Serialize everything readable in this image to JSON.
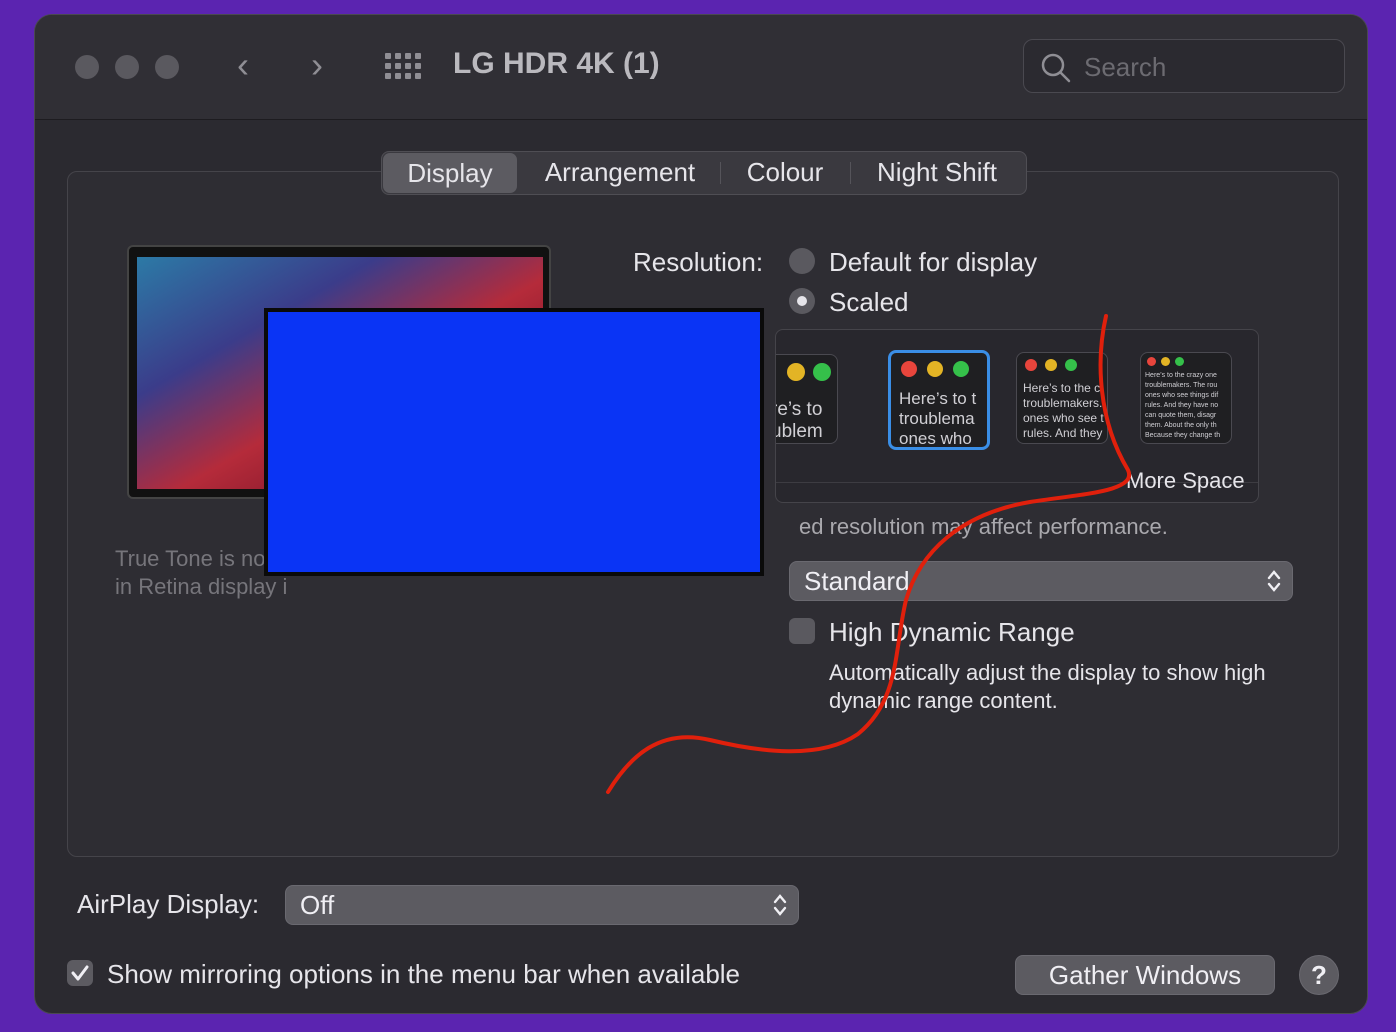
{
  "window": {
    "title": "LG HDR 4K (1)",
    "search_placeholder": "Search"
  },
  "tabs": [
    {
      "label": "Display",
      "active": true
    },
    {
      "label": "Arrangement",
      "active": false
    },
    {
      "label": "Colour",
      "active": false
    },
    {
      "label": "Night Shift",
      "active": false
    }
  ],
  "display": {
    "true_tone_line1": "True Tone is not a",
    "true_tone_line2": "in Retina display i",
    "resolution_label": "Resolution:",
    "option_default": "Default for display",
    "option_scaled": "Scaled",
    "selected_option": "Scaled",
    "scale_end_label": "More Space",
    "thumb_text_1": "re’s to\nublem",
    "thumb_text_2": "Here’s to t\ntroublema\nones who",
    "thumb_text_3": "Here’s to the c\ntroublemakers.\nones who see t\nrules. And they",
    "thumb_text_4": "Here’s to the crazy one\ntroublemakers. The rou\nones who see things dif\nrules. And they have no\ncan quote them, disagr\nthem. About the only th\nBecause they change th",
    "performance_note": "ed resolution may affect performance.",
    "preset_value": "Standard",
    "hdr_label": "High Dynamic Range",
    "hdr_checked": false,
    "hdr_desc_line1": "Automatically adjust the display to show high",
    "hdr_desc_line2": "dynamic range content."
  },
  "footer": {
    "airplay_label": "AirPlay Display:",
    "airplay_value": "Off",
    "mirroring_label": "Show mirroring options in the menu bar when available",
    "mirroring_checked": true,
    "gather_button": "Gather Windows",
    "help_button": "?"
  },
  "colors": {
    "window_bg": "#2b2a30",
    "desktop_bg": "#5b24b0",
    "accent_blue": "#3a8ee6",
    "redaction_blue": "#0a34f5",
    "annotation_red": "#e0200c"
  }
}
